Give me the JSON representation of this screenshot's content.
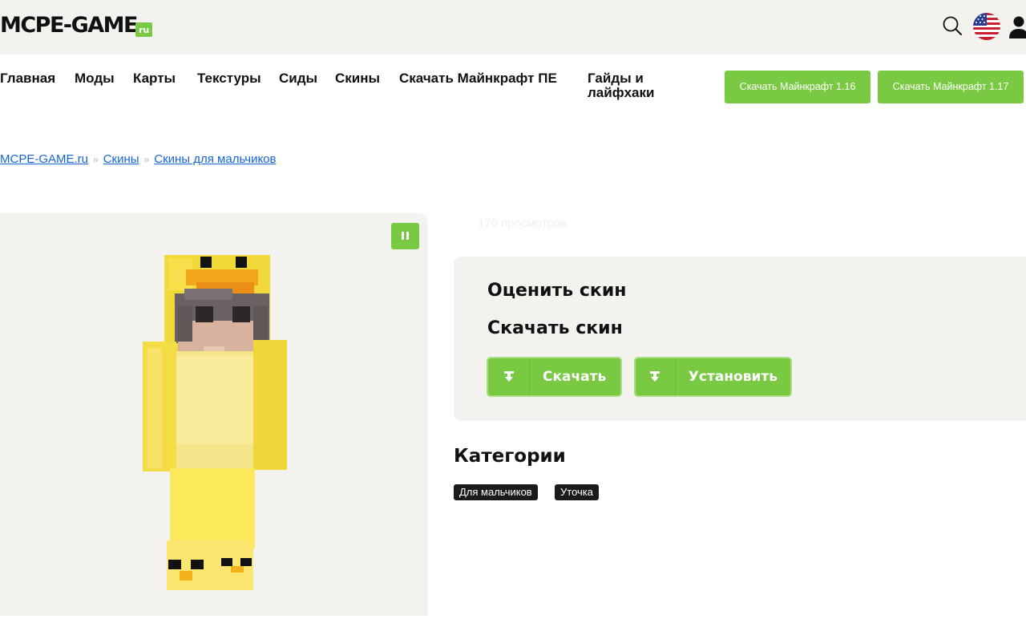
{
  "header": {
    "logo_main": "MCPE-GAME",
    "logo_tld": "ru",
    "colors": {
      "header_bg": "#f4f2ee",
      "accent_green": "#7ac943",
      "link_blue": "#1565d8"
    },
    "icons": [
      "search-icon",
      "us-flag-icon",
      "user-icon"
    ]
  },
  "nav": {
    "items": [
      "Главная",
      "Моды",
      "Карты",
      "Текстуры",
      "Сиды",
      "Скины",
      "Скачать Майнкрафт ПЕ",
      "Гайды и лайфхаки"
    ],
    "buttons": [
      "Скачать Майнкрафт 1.16",
      "Скачать Майнкрафт 1.17"
    ]
  },
  "breadcrumb": {
    "items": [
      "MCPE-GAME.ru",
      "Скины",
      "Скины для мальчиков"
    ],
    "separator": "»"
  },
  "skin": {
    "views": "170 просмотров",
    "preview_icon": "pause-icon",
    "description": "Minecraft skin of a boy in a yellow duck costume"
  },
  "actions": {
    "rate_title": "Оценить скин",
    "download_title": "Скачать скин",
    "download_button": "Скачать",
    "install_button": "Установить"
  },
  "categories": {
    "title": "Категории",
    "tags": [
      "Для мальчиков",
      "Уточка"
    ]
  }
}
